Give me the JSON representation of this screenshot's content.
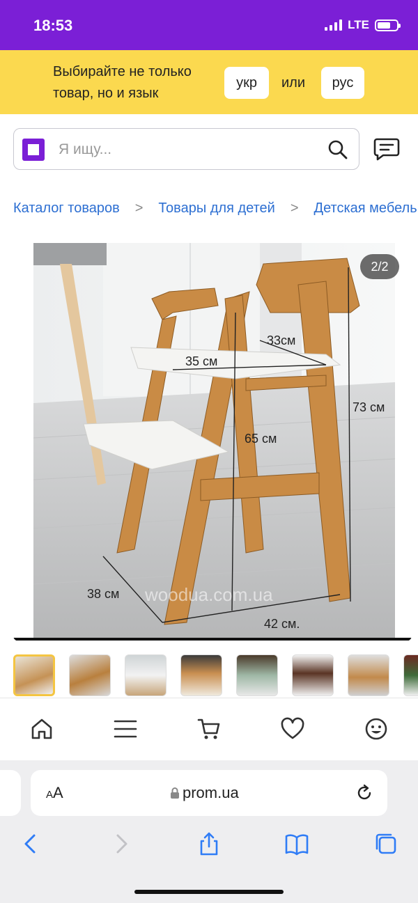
{
  "status_bar": {
    "time": "18:53",
    "network": "LTE"
  },
  "language_banner": {
    "text": "Выбирайте не только товар, но и язык",
    "ukr_label": "укр",
    "or_label": "или",
    "rus_label": "рус"
  },
  "search": {
    "placeholder": "Я ищу..."
  },
  "breadcrumb": [
    "Каталог товаров",
    "Товары для детей",
    "Детская мебель"
  ],
  "gallery": {
    "counter": "2/2",
    "dimensions": {
      "width_seat": "35 см",
      "depth_seat": "33см",
      "height_total": "73 см",
      "height_front": "65 см",
      "depth_base": "38 см",
      "width_base": "42 см."
    },
    "watermark": "woodua.com.ua"
  },
  "thumbnails_count": 8,
  "bottom_nav": {
    "items": [
      "home-icon",
      "menu-icon",
      "cart-icon",
      "heart-icon",
      "smiley-icon"
    ]
  },
  "browser": {
    "text_size_label": "AA",
    "url": "prom.ua"
  },
  "colors": {
    "brand": "#7b1fd6",
    "banner": "#fbd94f",
    "link": "#2d6fd2",
    "ios_blue": "#2f7cf6"
  }
}
